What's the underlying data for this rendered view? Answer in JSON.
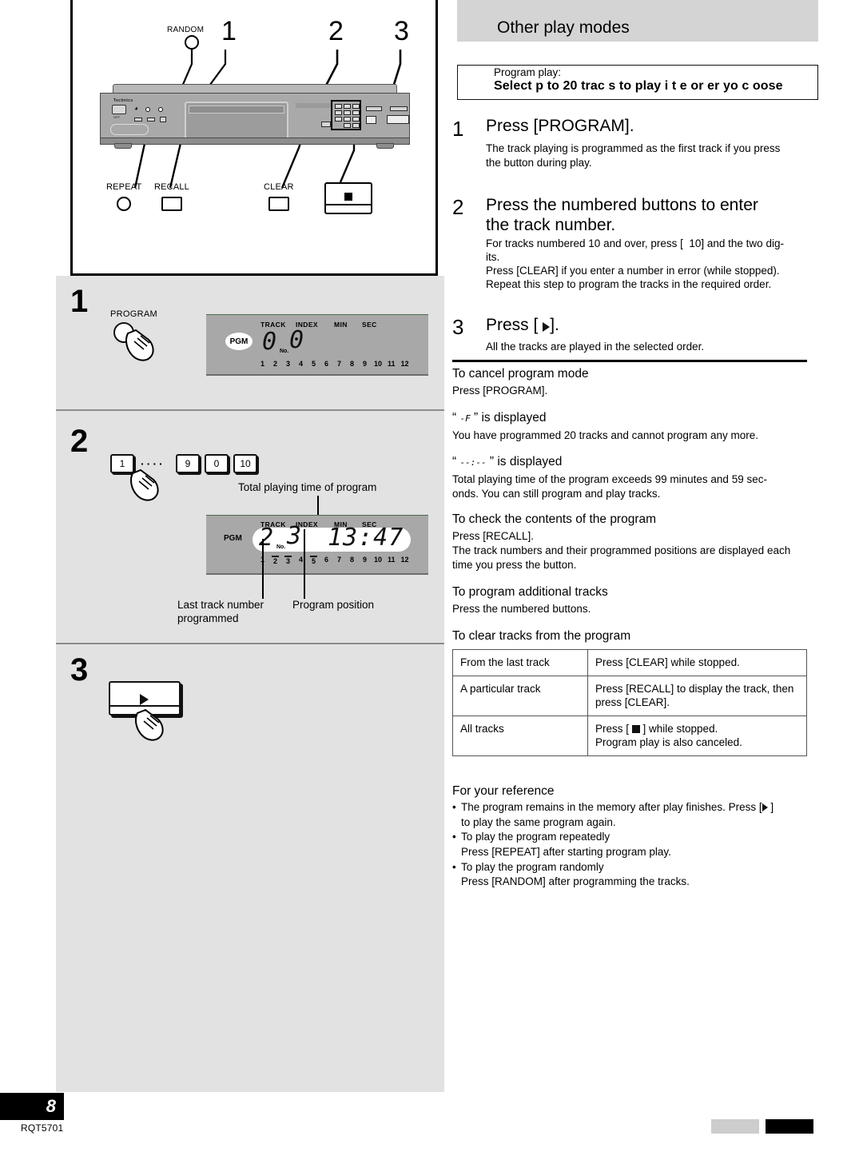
{
  "page": {
    "number": "8",
    "doc_code": "RQT5701"
  },
  "diagram": {
    "callouts": [
      {
        "id": "random-label",
        "text": "RANDOM"
      },
      {
        "id": "num-1",
        "text": "1"
      },
      {
        "id": "num-2",
        "text": "2"
      },
      {
        "id": "num-3",
        "text": "3"
      }
    ],
    "legend": [
      {
        "id": "repeat",
        "label": "REPEAT",
        "shape": "circle"
      },
      {
        "id": "recall",
        "label": "RECALL",
        "shape": "rect"
      },
      {
        "id": "clear",
        "label": "CLEAR",
        "shape": "rect"
      },
      {
        "id": "stop",
        "label": "",
        "shape": "stop-button"
      }
    ],
    "device_brand": "Technics",
    "power_label": "OFF"
  },
  "steps_left": [
    {
      "number": "1",
      "button_label": "PROGRAM",
      "lcd": {
        "pgm": "PGM",
        "headers": [
          "TRACK",
          "INDEX",
          "MIN",
          "SEC"
        ],
        "track_value": "0",
        "index_value": "0",
        "no_label": "No.",
        "time_value": "",
        "ticks": [
          "1",
          "2",
          "3",
          "4",
          "5",
          "6",
          "7",
          "8",
          "9",
          "10",
          "11",
          "12"
        ],
        "ticks_on": []
      }
    },
    {
      "number": "2",
      "keys": [
        "1",
        "9",
        "0",
        "10"
      ],
      "keys_dots": "····",
      "annotation_top": "Total playing time of program",
      "annotation_left": "Last track number\nprogrammed",
      "annotation_right": "Program position",
      "lcd": {
        "pgm": "PGM",
        "headers": [
          "TRACK",
          "INDEX",
          "MIN",
          "SEC"
        ],
        "track_value": "2",
        "index_value": "3",
        "no_label": "No.",
        "time_value": "13:47",
        "ticks": [
          "1",
          "2",
          "3",
          "4",
          "5",
          "6",
          "7",
          "8",
          "9",
          "10",
          "11",
          "12"
        ],
        "ticks_on": [
          "2",
          "3",
          "5"
        ]
      }
    },
    {
      "number": "3",
      "button_icon": "play-icon"
    }
  ],
  "right": {
    "header_title": "Other play modes",
    "program_play_label": "Program play:",
    "program_play_bold": "Select  p to 20 trac  s to play i   t  e or  er yo   c  oose",
    "steps": [
      {
        "number": "1",
        "heading": "Press [PROGRAM].",
        "body": "The track playing is programmed as the first track if you press\nthe button during play."
      },
      {
        "number": "2",
        "heading": "Press the numbered buttons to enter\nthe track number.",
        "body_lines": [
          "For tracks numbered 10 and over, press [  10] and the two dig-",
          "its.",
          "Press [CLEAR] if you enter a number in error (while stopped).",
          "Repeat this step to program the tracks in the required order."
        ]
      },
      {
        "number": "3",
        "heading_pre": "Press [ ",
        "heading_post": "].",
        "heading_icon": "play-icon",
        "body": "All the tracks are played in the selected order."
      }
    ],
    "sections": [
      {
        "id": "cancel-program-mode",
        "title": "To cancel program mode",
        "body": "Press [PROGRAM]."
      },
      {
        "id": "full-displayed",
        "title_pre": "“ ",
        "title_glyph": "-F",
        "title_post": " ” is displayed",
        "body": "You have programmed 20 tracks and cannot program any more."
      },
      {
        "id": "dashes-displayed",
        "title_pre": "“ ",
        "title_glyph": "--:--",
        "title_post": " ” is displayed",
        "body": "Total playing time of the program exceeds 99 minutes and 59 sec-\nonds. You can still program and play tracks."
      },
      {
        "id": "check-contents",
        "title": "To check the contents of the program",
        "body": "Press [RECALL].\nThe track numbers and their programmed positions are displayed each\ntime you press the button."
      },
      {
        "id": "program-additional",
        "title": "To program additional tracks",
        "body": "Press the numbered buttons."
      },
      {
        "id": "clear-tracks",
        "title": "To clear tracks from the program"
      }
    ],
    "clear_table": {
      "rows": [
        {
          "condition": "From the last track",
          "action": "Press [CLEAR] while stopped."
        },
        {
          "condition": "A particular track",
          "action": "Press [RECALL] to display the track, then\npress [CLEAR]."
        },
        {
          "condition": "All tracks",
          "action_pre": "Press [ ",
          "action_icon": "stop-icon",
          "action_post": " ] while stopped.",
          "action_line2": "Program play is also canceled."
        }
      ]
    },
    "reference": {
      "title": "For your reference",
      "items": [
        {
          "pre": "The program remains in the memory after play finishes. Press [",
          "icon": "play-icon",
          "post": " ]",
          "sub": "to play the same program again."
        },
        {
          "pre": "To play the program repeatedly",
          "sub": "Press [REPEAT] after starting program play."
        },
        {
          "pre": "To play the program randomly",
          "sub": "Press [RANDOM] after programming the tracks."
        }
      ]
    }
  }
}
